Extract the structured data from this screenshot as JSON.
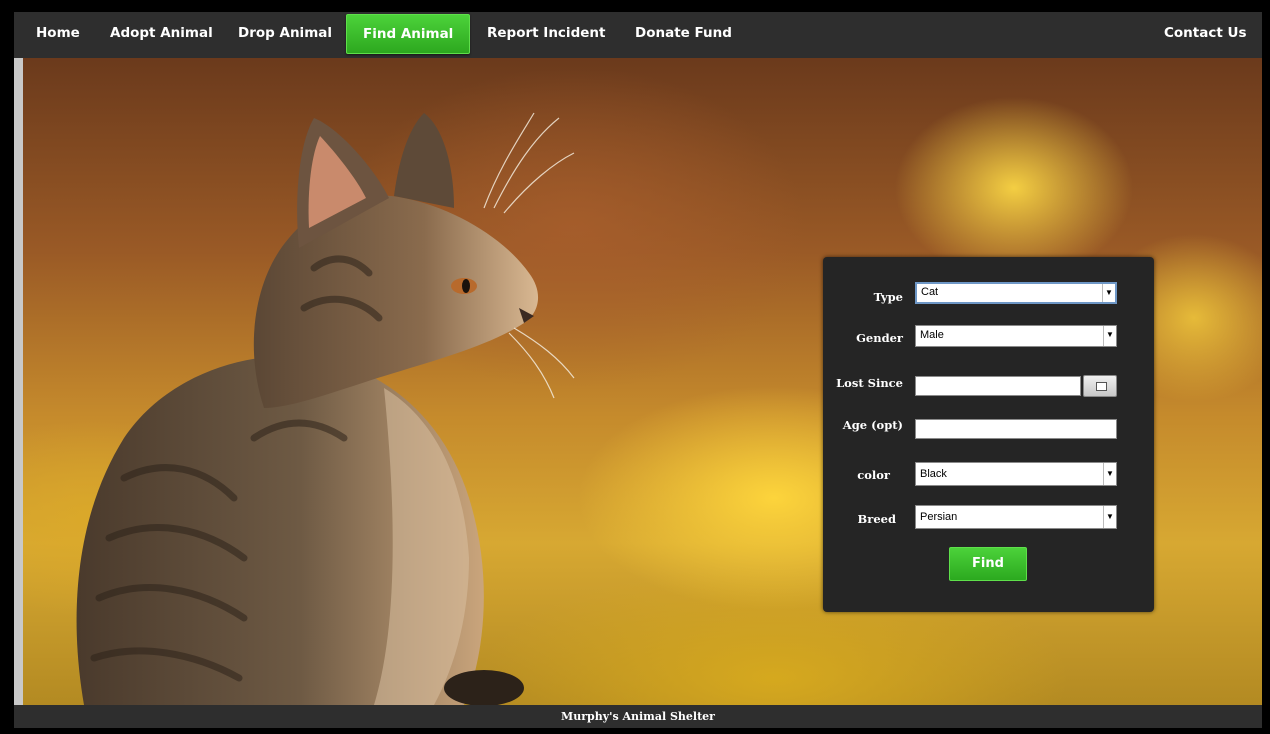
{
  "nav": {
    "items": [
      {
        "label": "Home"
      },
      {
        "label": "Adopt Animal"
      },
      {
        "label": "Drop Animal"
      },
      {
        "label": "Find Animal",
        "active": true
      },
      {
        "label": "Report Incident"
      },
      {
        "label": "Donate Fund"
      }
    ],
    "contact": "Contact Us"
  },
  "form": {
    "type": {
      "label": "Type",
      "value": "Cat"
    },
    "gender": {
      "label": "Gender",
      "value": "Male"
    },
    "lost_since": {
      "label": "Lost Since",
      "value": ""
    },
    "age": {
      "label": "Age (opt)",
      "value": ""
    },
    "color": {
      "label": "color",
      "value": "Black"
    },
    "breed": {
      "label": "Breed",
      "value": "Persian"
    },
    "submit_label": "Find"
  },
  "footer": {
    "text": "Murphy's Animal Shelter"
  },
  "colors": {
    "nav_bg": "#2e2e2e",
    "accent_green": "#3cbf2b",
    "panel_bg": "#252525"
  },
  "icons": {
    "calendar": "calendar-icon",
    "dropdown": "chevron-down-icon"
  }
}
